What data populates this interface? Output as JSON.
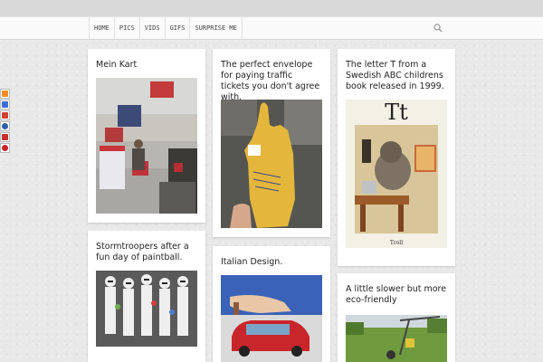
{
  "nav": {
    "items": [
      {
        "label": "HOME"
      },
      {
        "label": "PICS"
      },
      {
        "label": "VIDS"
      },
      {
        "label": "GIFS"
      },
      {
        "label": "SURPRISE ME"
      }
    ]
  },
  "social": [
    "rss-icon",
    "delicious-icon",
    "google-plus-icon",
    "stumbleupon-icon",
    "youtube-icon",
    "pinterest-icon"
  ],
  "posts": [
    {
      "title": "Mein Kart"
    },
    {
      "title": "The perfect envelope for paying traffic tickets you don't agree with."
    },
    {
      "title": "The letter T from a Swedish ABC childrens book released in 1999.",
      "image_caption": "Tt",
      "image_subcaption": "Troll"
    },
    {
      "title": "Stormtroopers after a fun day of paintball."
    },
    {
      "title": "Italian Design."
    },
    {
      "title": "A little slower but more eco-friendly"
    }
  ],
  "colors": {
    "nav_bg": "#fafafa",
    "page_bg": "#e8e8e8",
    "card_bg": "#ffffff"
  }
}
